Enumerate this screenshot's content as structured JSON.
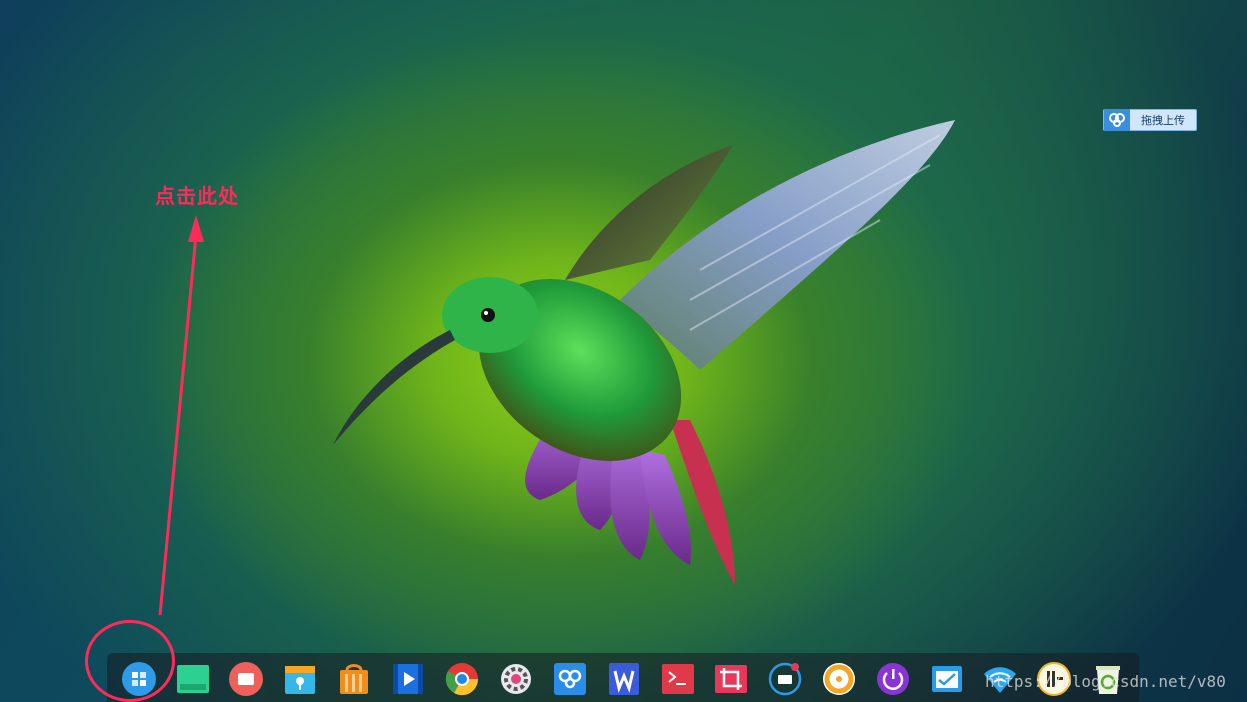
{
  "annotation": {
    "text": "点击此处",
    "color": "#ff2a5a"
  },
  "upload_widget": {
    "icon": "baidu-netdisk-icon",
    "label": "拖拽上传"
  },
  "dock": {
    "items": [
      {
        "name": "launcher-icon"
      },
      {
        "name": "multitask-view-icon"
      },
      {
        "name": "screen-recorder-icon"
      },
      {
        "name": "file-manager-icon"
      },
      {
        "name": "app-store-icon"
      },
      {
        "name": "video-player-icon"
      },
      {
        "name": "chrome-icon"
      },
      {
        "name": "settings-icon"
      },
      {
        "name": "baidu-netdisk-icon"
      },
      {
        "name": "wps-writer-icon"
      },
      {
        "name": "terminal-icon"
      },
      {
        "name": "screenshot-icon"
      },
      {
        "name": "input-method-icon"
      },
      {
        "name": "music-player-icon"
      },
      {
        "name": "power-icon"
      },
      {
        "name": "system-monitor-icon"
      },
      {
        "name": "wifi-icon"
      },
      {
        "name": "datetime-icon"
      },
      {
        "name": "trash-icon"
      }
    ]
  },
  "watermark": "https://blog.csdn.net/v80"
}
